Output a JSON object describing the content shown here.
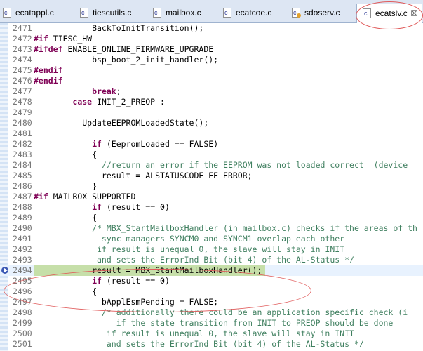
{
  "tabs": [
    {
      "label": "ecatappl.c"
    },
    {
      "label": "tiescutils.c"
    },
    {
      "label": "mailbox.c"
    },
    {
      "label": "ecatcoe.c"
    },
    {
      "label": "sdoserv.c"
    },
    {
      "label": "ecatslv.c",
      "active": true,
      "close": "☒"
    }
  ],
  "editor": {
    "lines": [
      {
        "num": "2471",
        "text": "            BackToInitTransition();"
      },
      {
        "num": "2472",
        "text": "#if TIESC_HW"
      },
      {
        "num": "2473",
        "text": "#ifdef ENABLE_ONLINE_FIRMWARE_UPGRADE"
      },
      {
        "num": "2474",
        "text": "            bsp_boot_2_init_handler();"
      },
      {
        "num": "2475",
        "text": "#endif"
      },
      {
        "num": "2476",
        "text": "#endif"
      },
      {
        "num": "2477",
        "text": "            break;"
      },
      {
        "num": "2478",
        "text": "        case INIT_2_PREOP :"
      },
      {
        "num": "2479",
        "text": ""
      },
      {
        "num": "2480",
        "text": "          UpdateEEPROMLoadedState();"
      },
      {
        "num": "2481",
        "text": ""
      },
      {
        "num": "2482",
        "text": "            if (EepromLoaded == FALSE)"
      },
      {
        "num": "2483",
        "text": "            {"
      },
      {
        "num": "2484",
        "text": "              //return an error if the EEPROM was not loaded correct  (device"
      },
      {
        "num": "2485",
        "text": "              result = ALSTATUSCODE_EE_ERROR;"
      },
      {
        "num": "2486",
        "text": "            }"
      },
      {
        "num": "2487",
        "text": "#if MAILBOX_SUPPORTED"
      },
      {
        "num": "2488",
        "text": "            if (result == 0)"
      },
      {
        "num": "2489",
        "text": "            {"
      },
      {
        "num": "2490",
        "text": "            /* MBX_StartMailboxHandler (in mailbox.c) checks if the areas of th"
      },
      {
        "num": "2491",
        "text": "              sync managers SYNCM0 and SYNCM1 overlap each other"
      },
      {
        "num": "2492",
        "text": "             if result is unequal 0, the slave will stay in INIT"
      },
      {
        "num": "2493",
        "text": "             and sets the ErrorInd Bit (bit 4) of the AL-Status */"
      },
      {
        "num": "2494",
        "text": "            result = MBX_StartMailboxHandler();"
      },
      {
        "num": "2495",
        "text": "            if (result == 0)"
      },
      {
        "num": "2496",
        "text": "            {"
      },
      {
        "num": "2497",
        "text": "              bApplEsmPending = FALSE;"
      },
      {
        "num": "2498",
        "text": "              /* additionally there could be an application specific check (i"
      },
      {
        "num": "2499",
        "text": "                 if the state transition from INIT to PREOP should be done"
      },
      {
        "num": "2500",
        "text": "               if result is unequal 0, the slave will stay in INIT"
      },
      {
        "num": "2501",
        "text": "               and sets the ErrorInd Bit (bit 4) of the AL-Status */"
      }
    ]
  }
}
